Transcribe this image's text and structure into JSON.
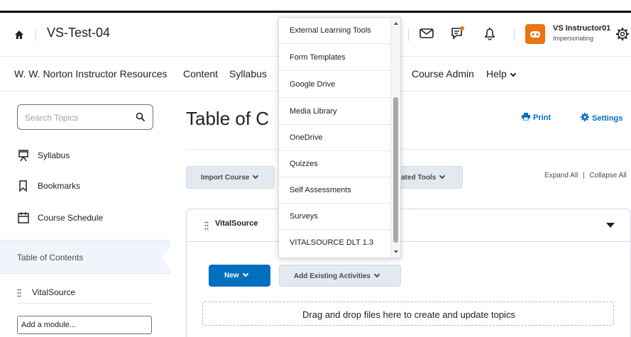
{
  "header": {
    "course_title": "VS-Test-04",
    "user_name": "VS Instructor01",
    "user_status": "Impersonating"
  },
  "nav": {
    "items": [
      "W. W. Norton Instructor Resources",
      "Content",
      "Syllabus",
      "Course Admin",
      "Help"
    ]
  },
  "sidebar": {
    "search_placeholder": "Search Topics",
    "links": [
      "Syllabus",
      "Bookmarks",
      "Course Schedule"
    ],
    "toc_label": "Table of Contents",
    "module_label": "VitalSource",
    "add_module_placeholder": "Add a module..."
  },
  "main": {
    "title": "Table of C",
    "print_label": "Print",
    "settings_label": "Settings",
    "import_label": "Import Course",
    "related_tools_label": "ated Tools",
    "expand_all": "Expand All",
    "collapse_all": "Collapse All",
    "module_name": "VitalSource",
    "new_label": "New",
    "add_existing_label": "Add Existing Activities",
    "drop_text": "Drag and drop files here to create and update topics"
  },
  "dropdown": {
    "items": [
      "External Learning Tools",
      "Form Templates",
      "Google Drive",
      "Media Library",
      "OneDrive",
      "Quizzes",
      "Self Assessments",
      "Surveys",
      "VITALSOURCE DLT 1.3"
    ]
  },
  "colors": {
    "primary_blue": "#006fbf",
    "avatar_orange": "#e87511",
    "notification_orange": "#e87511"
  }
}
